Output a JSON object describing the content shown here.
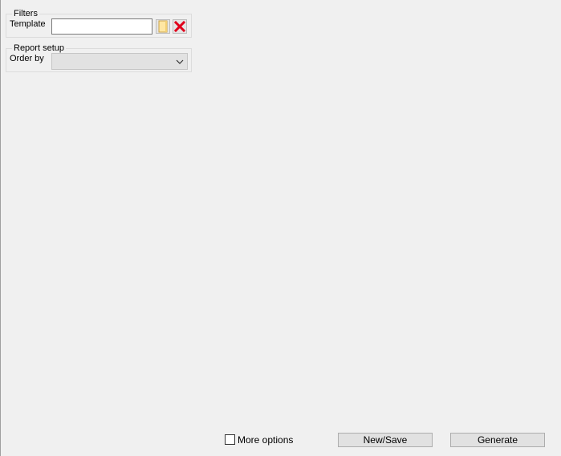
{
  "filters": {
    "title": "Filters",
    "template_label": "Template",
    "template_value": "",
    "folder_icon": "folder-icon",
    "clear_icon": "close-icon",
    "clear_icon_color": "#e0001b"
  },
  "report_setup": {
    "title": "Report setup",
    "order_by_label": "Order by",
    "order_by_value": ""
  },
  "footer": {
    "more_options_label": "More options",
    "more_options_checked": false,
    "new_save_label": "New/Save",
    "generate_label": "Generate"
  }
}
